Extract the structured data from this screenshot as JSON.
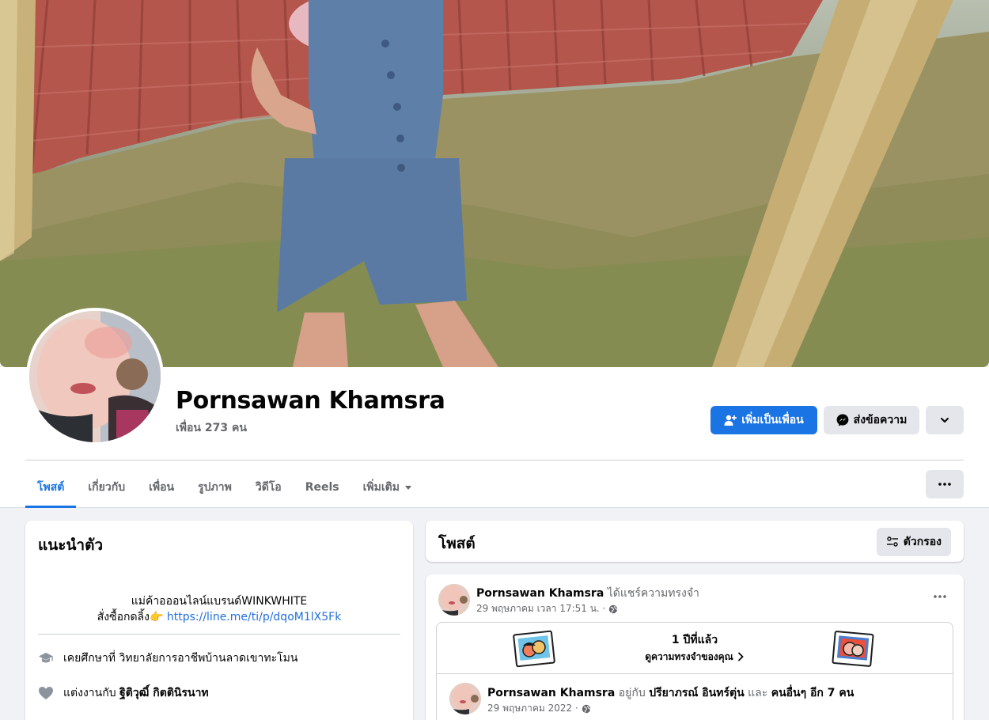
{
  "profile": {
    "name": "Pornsawan Khamsra",
    "friends_count": "เพื่อน 273 คน"
  },
  "actions": {
    "add_friend": "เพิ่มเป็นเพื่อน",
    "message": "ส่งข้อความ",
    "chevron_icon": "chevron-down-icon"
  },
  "tabs": [
    {
      "label": "โพสต์",
      "active": true
    },
    {
      "label": "เกี่ยวกับ"
    },
    {
      "label": "เพื่อน"
    },
    {
      "label": "รูปภาพ"
    },
    {
      "label": "วิดีโอ"
    },
    {
      "label": "Reels"
    },
    {
      "label": "เพิ่มเติม"
    }
  ],
  "intro": {
    "title": "แนะนำตัว",
    "bio_line1": "แม่ค้าอออนไลน์แบรนด์WINKWHITE",
    "bio_line2_prefix": "สั่งซื้อกดลิ้ง👉",
    "bio_link": "https://line.me/ti/p/dqoM1lX5Fk",
    "education_prefix": "เคยศึกษาที่",
    "education_school": "วิทยาลัยการอาชีพบ้านลาดเขาทะโมน",
    "married_prefix": "แต่งงานกับ",
    "married_to": "ฐิติวุฒิ์ กิตตินิรนาท"
  },
  "posts": {
    "title": "โพสต์",
    "filter": "ตัวกรอง"
  },
  "post": {
    "author": "Pornsawan Khamsra",
    "action": "ได้แชร์ความทรงจำ",
    "time": "29 พฤษภาคม เวลา 17:51 น. ·",
    "memory_years": "1 ปีที่แล้ว",
    "memory_see": "ดูความทรงจำของคุณ",
    "inner_author": "Pornsawan Khamsra",
    "inner_with_word": "อยู่กับ",
    "inner_tagged": "ปรียาภรณ์ อินทร์ตุ่น",
    "inner_and": "และ",
    "inner_others": "คนอื่นๆ อีก 7 คน",
    "inner_time": "29 พฤษภาคม 2022 ·"
  },
  "colors": {
    "accent": "#1b74e4",
    "link": "#216fdb",
    "secondary_btn": "#e4e6eb",
    "page_bg": "#f0f2f5"
  }
}
